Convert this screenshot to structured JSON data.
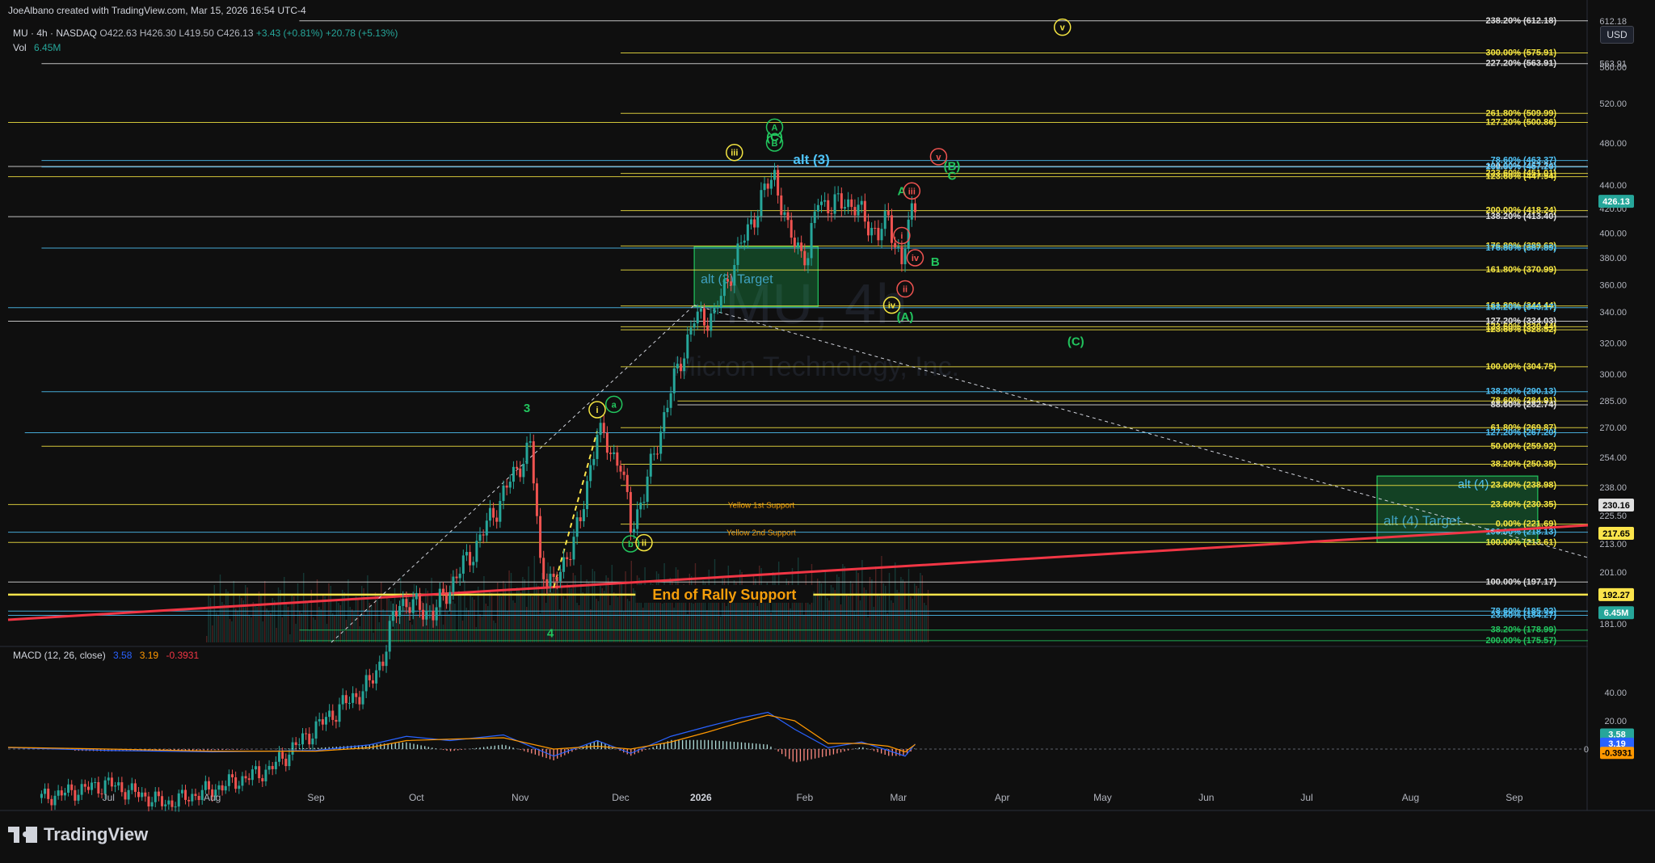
{
  "header": {
    "credit": "JoeAlbano created with TradingView.com, Mar 15, 2026 16:54 UTC-4",
    "symbol": "MU · 4h · NASDAQ",
    "ohlc": "O422.63 H426.30 L419.50 C426.13",
    "change": "+3.43 (+0.81%) +20.78 (+5.13%)",
    "vol_label": "Vol",
    "vol_value": "6.45M",
    "currency": "USD"
  },
  "watermark": {
    "ticker": "MU, 4h",
    "company": "Micron Technology, Inc."
  },
  "brand": "TradingView",
  "colors": {
    "up": "#26a69a",
    "down": "#ef5350",
    "yellow": "#f5e642",
    "cyan": "#4fc3f7",
    "white": "#e0e0e0",
    "green": "#22c55e",
    "orange": "#f59e0b",
    "red_trend": "#f23645",
    "macd": "#2962ff",
    "signal": "#ff9800"
  },
  "chart_data": [
    {
      "type": "line",
      "title": "MU · 4h · NASDAQ",
      "series": [
        {
          "x": [
            "2025-06-25",
            "2025-07-15",
            "2025-08-01",
            "2025-08-15",
            "2025-09-01",
            "2025-09-20",
            "2025-10-01",
            "2025-10-05",
            "2025-10-10",
            "2025-10-20",
            "2025-11-01",
            "2025-11-10",
            "2025-11-18",
            "2025-11-21",
            "2025-11-25",
            "2025-12-03",
            "2025-12-08",
            "2025-12-15",
            "2025-12-18",
            "2025-12-22",
            "2025-12-30",
            "2026-01-06",
            "2026-01-12",
            "2026-01-20",
            "2026-01-28",
            "2026-01-30",
            "2026-02-03",
            "2026-02-09",
            "2026-02-12",
            "2026-02-16",
            "2026-02-20",
            "2026-02-25",
            "2026-03-02",
            "2026-03-05",
            "2026-03-09",
            "2026-03-12",
            "2026-03-13"
          ],
          "values": [
            120,
            125,
            118,
            123,
            130,
            150,
            160,
            170,
            190,
            185,
            210,
            235,
            260,
            205,
            195,
            222,
            268,
            250,
            220,
            235,
            290,
            335,
            338,
            390,
            440,
            450,
            400,
            380,
            430,
            420,
            428,
            415,
            398,
            412,
            375,
            418,
            426
          ]
        }
      ],
      "volume_last": "6.45M",
      "axis_price_ticks": [
        "612.18",
        "563.91",
        "560.00",
        "520.00",
        "480.00",
        "440.00",
        "426.13",
        "420.00",
        "400.00",
        "380.00",
        "360.00",
        "340.00",
        "320.00",
        "300.00",
        "285.00",
        "270.00",
        "254.00",
        "238.00",
        "230.16",
        "225.50",
        "217.65",
        "213.00",
        "201.00",
        "192.27",
        "6.45M",
        "181.00"
      ],
      "time_ticks": [
        "Jul",
        "Aug",
        "Sep",
        "Oct",
        "Nov",
        "Dec",
        "2026",
        "Feb",
        "Mar",
        "Apr",
        "May",
        "Jun",
        "Jul",
        "Aug",
        "Sep"
      ],
      "price_tags": [
        {
          "label": "426.13",
          "color": "#26a69a"
        },
        {
          "label": "230.16",
          "color": "#e0e0e0"
        },
        {
          "label": "217.65",
          "color": "#fbe44b"
        },
        {
          "label": "192.27",
          "color": "#fbe44b"
        },
        {
          "label": "6.45M",
          "color": "#26a69a"
        }
      ],
      "fib_levels": [
        {
          "label": "238.20% (612.18)",
          "price": 612.18,
          "color": "white",
          "start": "2025-09-10"
        },
        {
          "label": "300.00% (575.91)",
          "price": 575.91,
          "color": "yellow",
          "start": "2025-12-15"
        },
        {
          "label": "227.20% (563.91)",
          "price": 563.91,
          "color": "white",
          "start": "2025-06-25"
        },
        {
          "label": "261.80% (509.99)",
          "price": 509.99,
          "color": "yellow",
          "start": "2025-12-15"
        },
        {
          "label": "127.20% (500.86)",
          "price": 500.86,
          "color": "yellow",
          "start": "2025-06-15"
        },
        {
          "label": "78.60% (463.37)",
          "price": 463.37,
          "color": "cyan",
          "start": "2025-06-25"
        },
        {
          "label": "100.00% (457.74)",
          "price": 457.74,
          "color": "white",
          "start": "2025-06-15"
        },
        {
          "label": "261.80% (457.20)",
          "price": 457.2,
          "color": "cyan",
          "start": "2025-06-25"
        },
        {
          "label": "223.60% (451.01)",
          "price": 451.01,
          "color": "yellow",
          "start": "2025-12-15"
        },
        {
          "label": "123.60% (447.94)",
          "price": 447.94,
          "color": "yellow",
          "start": "2025-06-15"
        },
        {
          "label": "200.00% (418.24)",
          "price": 418.24,
          "color": "yellow",
          "start": "2025-12-15"
        },
        {
          "label": "138.20% (413.40)",
          "price": 413.4,
          "color": "white",
          "start": "2025-06-15"
        },
        {
          "label": "176.80% (389.62)",
          "price": 389.62,
          "color": "yellow",
          "start": "2025-12-15"
        },
        {
          "label": "176.80% (387.89)",
          "price": 387.89,
          "color": "cyan",
          "start": "2025-06-25"
        },
        {
          "label": "161.80% (370.99)",
          "price": 370.99,
          "color": "yellow",
          "start": "2025-12-15"
        },
        {
          "label": "161.80% (344.44)",
          "price": 344.44,
          "color": "yellow",
          "start": "2025-12-15"
        },
        {
          "label": "138.20% (343.17)",
          "price": 343.17,
          "color": "cyan",
          "start": "2025-06-15"
        },
        {
          "label": "127.20% (334.03)",
          "price": 334.03,
          "color": "white",
          "start": "2025-06-15"
        },
        {
          "label": "123.60% (330.44)",
          "price": 330.44,
          "color": "yellow",
          "start": "2025-12-15"
        },
        {
          "label": "123.60% (328.52)",
          "price": 328.52,
          "color": "yellow",
          "start": "2025-12-15"
        },
        {
          "label": "100.00% (304.75)",
          "price": 304.75,
          "color": "yellow",
          "start": "2025-12-15"
        },
        {
          "label": "138.20% (290.13)",
          "price": 290.13,
          "color": "cyan",
          "start": "2025-06-25"
        },
        {
          "label": "78.60% (284.91)",
          "price": 284.91,
          "color": "yellow",
          "start": "2026-01-01"
        },
        {
          "label": "88.60% (282.74)",
          "price": 282.74,
          "color": "white",
          "start": "2026-01-01"
        },
        {
          "label": "61.80% (269.87)",
          "price": 269.87,
          "color": "yellow",
          "start": "2025-12-15"
        },
        {
          "label": "127.20% (267.20)",
          "price": 267.2,
          "color": "cyan",
          "start": "2025-06-20"
        },
        {
          "label": "50.00% (259.92)",
          "price": 259.92,
          "color": "yellow",
          "start": "2025-06-25"
        },
        {
          "label": "38.20% (250.35)",
          "price": 250.35,
          "color": "yellow",
          "start": "2025-12-15"
        },
        {
          "label": "23.60% (238.98)",
          "price": 238.98,
          "color": "yellow",
          "start": "2025-12-15"
        },
        {
          "label": "23.60% (230.35)",
          "price": 230.35,
          "color": "yellow",
          "start": "2025-06-15"
        },
        {
          "label": "0.00% (221.69)",
          "price": 221.69,
          "color": "yellow",
          "start": "2025-12-15"
        },
        {
          "label": "100.00% (218.13)",
          "price": 218.13,
          "color": "cyan",
          "start": "2025-06-15"
        },
        {
          "label": "100.00% (213.61)",
          "price": 213.61,
          "color": "yellow",
          "start": "2025-06-15"
        },
        {
          "label": "100.00% (197.17)",
          "price": 197.17,
          "color": "white",
          "start": "2025-06-15"
        },
        {
          "label": "78.60% (185.92)",
          "price": 185.92,
          "color": "cyan",
          "start": "2025-06-15"
        },
        {
          "label": "23.60% (184.27)",
          "price": 184.27,
          "color": "cyan",
          "start": "2025-06-15"
        },
        {
          "label": "38.20% (178.99)",
          "price": 178.99,
          "color": "green",
          "start": "2025-09-10"
        },
        {
          "label": "200.00% (175.57)",
          "price": 175.57,
          "color": "green",
          "start": "2025-09-10"
        }
      ],
      "support_labels": [
        {
          "text": "Yellow 1st Support",
          "price": 230.35,
          "date": "2026-01-26"
        },
        {
          "text": "Yellow 2nd Support",
          "price": 218.13,
          "date": "2026-01-26"
        },
        {
          "text": "End of Rally Support",
          "price": 192.27,
          "date": "2026-01-15"
        }
      ],
      "zones": [
        {
          "label": "alt (3) Target",
          "from": "2026-01-06",
          "to": "2026-02-12",
          "low": 344,
          "high": 389
        },
        {
          "label": "alt (4) Target",
          "label2": "alt (4)",
          "from": "2026-07-29",
          "to": "2026-09-15",
          "low": 213.6,
          "high": 244
        }
      ],
      "wave_labels": [
        {
          "text": "v",
          "date": "2026-04-26",
          "price": 605,
          "style": "circle",
          "color": "yellow"
        },
        {
          "text": "A",
          "date": "2026-01-30",
          "price": 496,
          "style": "circle",
          "color": "green"
        },
        {
          "text": "C",
          "date": "2026-01-30",
          "price": 486,
          "style": "paren",
          "color": "green"
        },
        {
          "text": "B",
          "date": "2026-01-30",
          "price": 480,
          "style": "circle",
          "color": "green"
        },
        {
          "text": "iii",
          "date": "2026-01-18",
          "price": 471,
          "style": "circle",
          "color": "yellow"
        },
        {
          "text": "alt (3)",
          "date": "2026-02-10",
          "price": 464,
          "style": "text",
          "color": "cyan"
        },
        {
          "text": "v",
          "date": "2026-03-20",
          "price": 467,
          "style": "circle",
          "color": "red"
        },
        {
          "text": "B",
          "date": "2026-03-24",
          "price": 458,
          "style": "paren",
          "color": "green"
        },
        {
          "text": "C",
          "date": "2026-03-24",
          "price": 449,
          "style": "text",
          "color": "green"
        },
        {
          "text": "A",
          "date": "2026-03-09",
          "price": 435,
          "style": "text",
          "color": "green"
        },
        {
          "text": "iii",
          "date": "2026-03-12",
          "price": 435,
          "style": "circle",
          "color": "red"
        },
        {
          "text": "i",
          "date": "2026-03-09",
          "price": 398,
          "style": "circle",
          "color": "red"
        },
        {
          "text": "iv",
          "date": "2026-03-13",
          "price": 380,
          "style": "circle",
          "color": "red"
        },
        {
          "text": "B",
          "date": "2026-03-19",
          "price": 377,
          "style": "text",
          "color": "green"
        },
        {
          "text": "ii",
          "date": "2026-03-10",
          "price": 357,
          "style": "circle",
          "color": "red"
        },
        {
          "text": "iv",
          "date": "2026-03-06",
          "price": 345,
          "style": "circle",
          "color": "yellow"
        },
        {
          "text": "A",
          "date": "2026-03-10",
          "price": 337,
          "style": "paren",
          "color": "green"
        },
        {
          "text": "C",
          "date": "2026-04-30",
          "price": 321,
          "style": "paren",
          "color": "green"
        },
        {
          "text": "3",
          "date": "2025-11-17",
          "price": 281,
          "style": "text",
          "color": "green"
        },
        {
          "text": "i",
          "date": "2025-12-08",
          "price": 280,
          "style": "circle",
          "color": "yellow"
        },
        {
          "text": "a",
          "date": "2025-12-13",
          "price": 283,
          "style": "circle",
          "color": "green"
        },
        {
          "text": "b",
          "date": "2025-12-18",
          "price": 213,
          "style": "circle",
          "color": "green"
        },
        {
          "text": "ii",
          "date": "2025-12-22",
          "price": 213.5,
          "style": "circle",
          "color": "yellow"
        },
        {
          "text": "4",
          "date": "2025-11-24",
          "price": 178,
          "style": "text",
          "color": "green"
        }
      ]
    },
    {
      "type": "line",
      "title": "MACD (12, 26, close)",
      "values_text": [
        "3.58",
        "3.19",
        "-0.3931"
      ],
      "y_ticks": [
        "40.00",
        "20.00",
        "0.00"
      ],
      "series": [
        {
          "name": "MACD",
          "x": [
            "2025-06-15",
            "2025-07-15",
            "2025-08-15",
            "2025-09-15",
            "2025-10-01",
            "2025-10-12",
            "2025-10-25",
            "2025-11-10",
            "2025-11-25",
            "2025-12-08",
            "2025-12-18",
            "2025-12-30",
            "2026-01-10",
            "2026-01-20",
            "2026-01-28",
            "2026-02-05",
            "2026-02-15",
            "2026-02-25",
            "2026-03-05",
            "2026-03-10",
            "2026-03-13"
          ],
          "values": [
            1,
            -1,
            -2,
            -1,
            3,
            9,
            6,
            10,
            -5,
            6,
            -3,
            9,
            16,
            22,
            26,
            14,
            1,
            5,
            -1,
            -5,
            3.58
          ]
        },
        {
          "name": "Signal",
          "x": [
            "2025-06-15",
            "2025-07-15",
            "2025-08-15",
            "2025-09-15",
            "2025-10-01",
            "2025-10-12",
            "2025-10-25",
            "2025-11-10",
            "2025-11-25",
            "2025-12-08",
            "2025-12-18",
            "2025-12-30",
            "2026-01-10",
            "2026-01-20",
            "2026-01-28",
            "2026-02-05",
            "2026-02-15",
            "2026-02-25",
            "2026-03-05",
            "2026-03-10",
            "2026-03-13"
          ],
          "values": [
            1.2,
            0,
            -1.5,
            -1.5,
            1,
            6,
            7,
            8,
            0,
            2,
            0,
            5,
            12,
            19,
            24,
            20,
            4,
            4,
            2,
            -2,
            3.19
          ]
        }
      ]
    }
  ]
}
